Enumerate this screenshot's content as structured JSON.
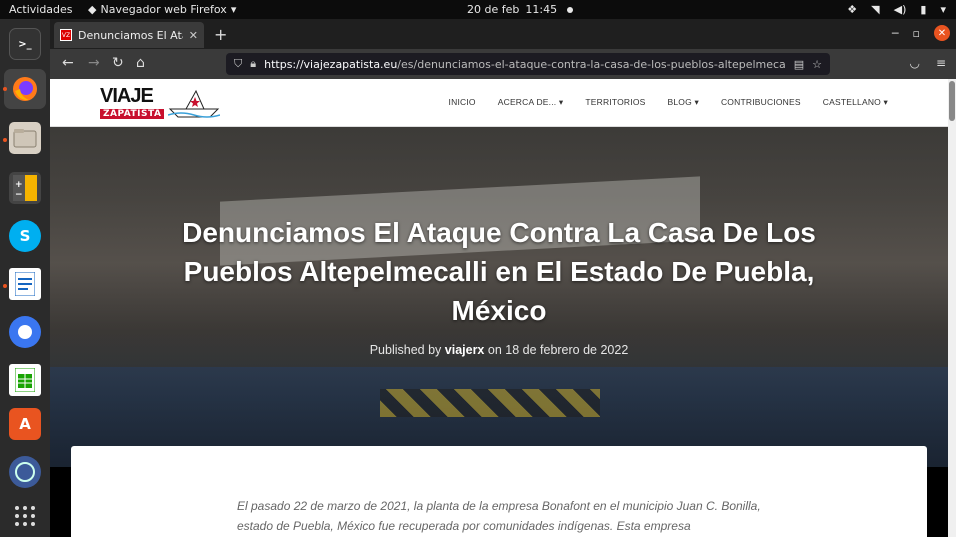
{
  "system": {
    "activities": "Actividades",
    "app_menu": "Navegador web Firefox",
    "date": "20 de feb",
    "time": "11:45"
  },
  "browser": {
    "tab_title": "Denunciamos El Ataque C",
    "url_host": "https://viajezapatista.eu",
    "url_path": "/es/denunciamos-el-ataque-contra-la-casa-de-los-pueblos-altepelmecalli-en-el-est"
  },
  "site": {
    "logo_top": "VIAJE",
    "logo_bottom": "ZAPATISTA",
    "menu": [
      "INICIO",
      "ACERCA DE...",
      "TERRITORIOS",
      "BLOG",
      "CONTRIBUCIONES",
      "CASTELLANO"
    ]
  },
  "article": {
    "title": "Denunciamos El Ataque Contra La Casa De Los Pueblos Altepelmecalli en El Estado De Puebla, México",
    "published_by": "Published by",
    "author": "viajerx",
    "date_prefix": "on",
    "date": "18 de febrero de 2022",
    "intro": "El pasado 22 de marzo de 2021, la planta de la empresa Bonafont en el municipio Juan C. Bonilla, estado de Puebla, México fue recuperada por comunidades indígenas. Esta empresa"
  },
  "colors": {
    "accent": "#e95420",
    "logo_red": "#c8102e"
  }
}
